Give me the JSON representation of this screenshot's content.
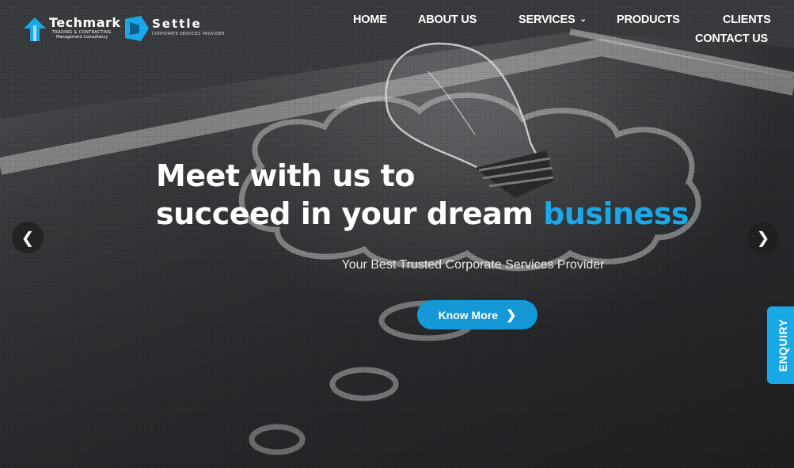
{
  "brand": {
    "primary_name": "Techmark",
    "primary_tagline": "TRADING & CONTRACTING",
    "primary_subtitle": "Management Consultancy",
    "secondary_name": "Settle",
    "secondary_tagline": "CORPORATE SERVICES PROVIDER",
    "accent_color": "#1aa8e8"
  },
  "nav": {
    "home": "HOME",
    "about": "ABOUT US",
    "services": "SERVICES",
    "products": "PRODUCTS",
    "clients": "CLIENTS",
    "contact": "CONTACT US",
    "services_icon": "chevron-down-icon"
  },
  "hero": {
    "headline_line1": "Meet with us to",
    "headline_line2_prefix": "succeed in your dream ",
    "headline_highlight": "business",
    "tagline": "Your Best Trusted Corporate Services Provider",
    "cta_label": "Know More",
    "cta_icon": "chevron-right-icon",
    "prev_icon": "chevron-left-icon",
    "next_icon": "chevron-right-icon"
  },
  "enquiry": {
    "label": "ENQUIRY"
  }
}
